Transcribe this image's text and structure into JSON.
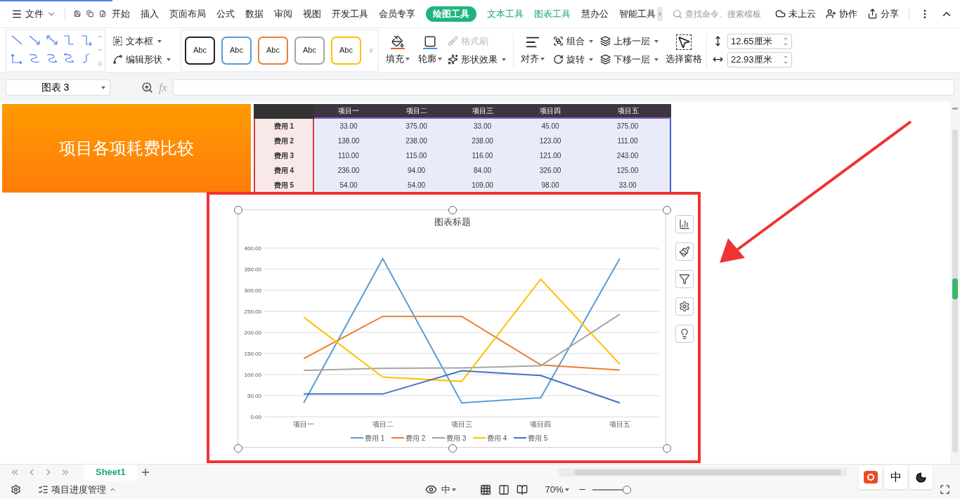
{
  "menu": {
    "file": "文件",
    "tabs": [
      {
        "label": "开始",
        "selected": false,
        "kind": "normal"
      },
      {
        "label": "插入",
        "selected": false,
        "kind": "normal"
      },
      {
        "label": "页面布局",
        "selected": false,
        "kind": "normal"
      },
      {
        "label": "公式",
        "selected": false,
        "kind": "normal"
      },
      {
        "label": "数据",
        "selected": false,
        "kind": "normal"
      },
      {
        "label": "审阅",
        "selected": false,
        "kind": "normal"
      },
      {
        "label": "视图",
        "selected": false,
        "kind": "normal"
      },
      {
        "label": "开发工具",
        "selected": false,
        "kind": "normal"
      },
      {
        "label": "会员专享",
        "selected": false,
        "kind": "normal"
      },
      {
        "label": "绘图工具",
        "selected": true,
        "kind": "contextual"
      },
      {
        "label": "文本工具",
        "selected": false,
        "kind": "contextual"
      },
      {
        "label": "图表工具",
        "selected": false,
        "kind": "contextual"
      },
      {
        "label": "慧办公",
        "selected": false,
        "kind": "normal"
      },
      {
        "label": "智能工具",
        "selected": false,
        "kind": "normal"
      }
    ],
    "search": {
      "placeholder": "查找命令、搜索模板"
    },
    "actions": [
      "未上云",
      "协作",
      "分享"
    ]
  },
  "ribbon": {
    "text_box": "文本框",
    "edit_shape": "编辑形状",
    "styles": [
      {
        "label": "Abc",
        "color": "#222222"
      },
      {
        "label": "Abc",
        "color": "#5b9bd5"
      },
      {
        "label": "Abc",
        "color": "#ed7d31"
      },
      {
        "label": "Abc",
        "color": "#a5a5a5"
      },
      {
        "label": "Abc",
        "color": "#ffc000"
      }
    ],
    "fill": "填充",
    "outline": "轮廓",
    "format_painter": {
      "label": "格式刷",
      "disabled": true
    },
    "shape_effects": "形状效果",
    "align": "对齐",
    "group": "组合",
    "rotate": "旋转",
    "bring_forward": "上移一层",
    "send_backward": "下移一层",
    "selection_pane": "选择窗格",
    "height": "12.65厘米",
    "width": "22.93厘米"
  },
  "formula_bar": {
    "name_box": "图表 3",
    "fx": "fx"
  },
  "sheet": {
    "title_shape": "项目各项耗费比较",
    "table": {
      "columns": [
        "项目一",
        "项目二",
        "项目三",
        "项目四",
        "项目五"
      ],
      "rows": [
        {
          "label": "费用 1",
          "cells": [
            "33.00",
            "375.00",
            "33.00",
            "45.00",
            "375.00"
          ]
        },
        {
          "label": "费用 2",
          "cells": [
            "138.00",
            "238.00",
            "238.00",
            "123.00",
            "111.00"
          ]
        },
        {
          "label": "费用 3",
          "cells": [
            "110.00",
            "115.00",
            "116.00",
            "121.00",
            "243.00"
          ]
        },
        {
          "label": "费用 4",
          "cells": [
            "236.00",
            "94.00",
            "84.00",
            "326.00",
            "125.00"
          ]
        },
        {
          "label": "费用 5",
          "cells": [
            "54.00",
            "54.00",
            "109.00",
            "98.00",
            "33.00"
          ]
        }
      ]
    },
    "chart": {
      "chart_data": {
        "type": "line",
        "title": "图表标题",
        "categories": [
          "项目一",
          "项目二",
          "项目三",
          "项目四",
          "项目五"
        ],
        "series": [
          {
            "name": "费用 1",
            "color": "#5b9bd5",
            "values": [
              33,
              375,
              33,
              45,
              375
            ]
          },
          {
            "name": "费用 2",
            "color": "#ed7d31",
            "values": [
              138,
              238,
              238,
              123,
              111
            ]
          },
          {
            "name": "费用 3",
            "color": "#a5a5a5",
            "values": [
              110,
              115,
              116,
              121,
              243
            ]
          },
          {
            "name": "费用 4",
            "color": "#ffc000",
            "values": [
              236,
              94,
              84,
              326,
              125
            ]
          },
          {
            "name": "费用 5",
            "color": "#4472c4",
            "values": [
              54,
              54,
              109,
              98,
              33
            ]
          }
        ],
        "ylim": [
          0,
          400
        ],
        "grid": true,
        "legend": true,
        "yticks": [
          {
            "value": 0,
            "label": "0.00"
          },
          {
            "value": 50,
            "label": "50.00"
          },
          {
            "value": 100,
            "label": "100.00"
          },
          {
            "value": 150,
            "label": "150.00"
          },
          {
            "value": 200,
            "label": "200.00"
          },
          {
            "value": 250,
            "label": "250.00"
          },
          {
            "value": 300,
            "label": "300.00"
          },
          {
            "value": 350,
            "label": "350.00"
          },
          {
            "value": 400,
            "label": "400.00"
          }
        ]
      }
    }
  },
  "sheet_tabs": [
    {
      "label": "Sheet1",
      "selected": true
    }
  ],
  "status_bar": {
    "workbook": "项目进度管理",
    "language": "中",
    "zoom": "70%",
    "zoom_slider": {
      "level": 0.9
    }
  },
  "ime_toolbar": {
    "mode": "中"
  }
}
